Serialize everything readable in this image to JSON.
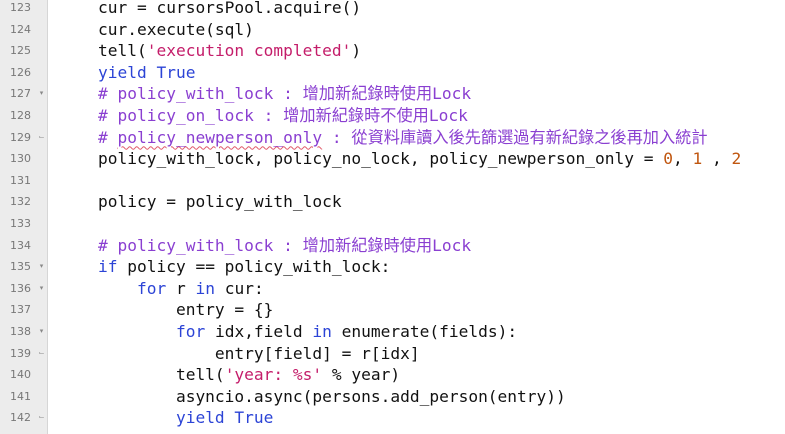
{
  "editor": {
    "lines": [
      {
        "n": "123",
        "fold": "",
        "segs": [
          {
            "t": "    cur = cursorsPool.acquire()"
          }
        ]
      },
      {
        "n": "124",
        "fold": "",
        "segs": [
          {
            "t": "    cur.execute(sql)"
          }
        ]
      },
      {
        "n": "125",
        "fold": "",
        "segs": [
          {
            "t": "    tell("
          },
          {
            "t": "'execution completed'",
            "c": "str"
          },
          {
            "t": ")"
          }
        ]
      },
      {
        "n": "126",
        "fold": "",
        "segs": [
          {
            "t": "    "
          },
          {
            "t": "yield True",
            "c": "kw"
          }
        ]
      },
      {
        "n": "127",
        "fold": "▾",
        "segs": [
          {
            "t": "    "
          },
          {
            "t": "# policy_with_lock : 增加新紀錄時使用Lock",
            "c": "cm"
          }
        ]
      },
      {
        "n": "128",
        "fold": "",
        "segs": [
          {
            "t": "    "
          },
          {
            "t": "# policy_on_lock : 增加新紀錄時不使用Lock",
            "c": "cm"
          }
        ]
      },
      {
        "n": "129",
        "fold": "⌙",
        "segs": [
          {
            "t": "    "
          },
          {
            "t": "# ",
            "c": "cm"
          },
          {
            "t": "policy_newperson_only",
            "c": "cm squiggle"
          },
          {
            "t": " : 從資料庫讀入後先篩選過有新紀錄之後再加入統計",
            "c": "cm"
          }
        ]
      },
      {
        "n": "130",
        "fold": "",
        "segs": [
          {
            "t": "    policy_with_lock, policy_no_lock, policy_newperson_only = "
          },
          {
            "t": "0",
            "c": "num"
          },
          {
            "t": ", "
          },
          {
            "t": "1",
            "c": "num"
          },
          {
            "t": " , "
          },
          {
            "t": "2",
            "c": "num"
          }
        ]
      },
      {
        "n": "131",
        "fold": "",
        "segs": [
          {
            "t": ""
          }
        ]
      },
      {
        "n": "132",
        "fold": "",
        "segs": [
          {
            "t": "    policy = policy_with_lock"
          }
        ]
      },
      {
        "n": "133",
        "fold": "",
        "segs": [
          {
            "t": ""
          }
        ]
      },
      {
        "n": "134",
        "fold": "",
        "segs": [
          {
            "t": "    "
          },
          {
            "t": "# policy_with_lock : 增加新紀錄時使用Lock",
            "c": "cm"
          }
        ]
      },
      {
        "n": "135",
        "fold": "▾",
        "segs": [
          {
            "t": "    "
          },
          {
            "t": "if",
            "c": "kw"
          },
          {
            "t": " policy == policy_with_lock:"
          }
        ]
      },
      {
        "n": "136",
        "fold": "▾",
        "segs": [
          {
            "t": "        "
          },
          {
            "t": "for",
            "c": "kw"
          },
          {
            "t": " r "
          },
          {
            "t": "in",
            "c": "kw"
          },
          {
            "t": " cur:"
          }
        ]
      },
      {
        "n": "137",
        "fold": "",
        "segs": [
          {
            "t": "            entry = {}"
          }
        ]
      },
      {
        "n": "138",
        "fold": "▾",
        "segs": [
          {
            "t": "            "
          },
          {
            "t": "for",
            "c": "kw"
          },
          {
            "t": " idx,field "
          },
          {
            "t": "in",
            "c": "kw"
          },
          {
            "t": " enumerate(fields):"
          }
        ]
      },
      {
        "n": "139",
        "fold": "⌙",
        "segs": [
          {
            "t": "                entry[field] = r[idx]"
          }
        ]
      },
      {
        "n": "140",
        "fold": "",
        "segs": [
          {
            "t": "            tell("
          },
          {
            "t": "'year: %s'",
            "c": "str"
          },
          {
            "t": " % year)"
          }
        ]
      },
      {
        "n": "141",
        "fold": "",
        "segs": [
          {
            "t": "            asyncio.async(persons.add_person(entry))"
          }
        ]
      },
      {
        "n": "142",
        "fold": "⌙",
        "segs": [
          {
            "t": "            "
          },
          {
            "t": "yield True",
            "c": "kw"
          }
        ]
      }
    ]
  }
}
